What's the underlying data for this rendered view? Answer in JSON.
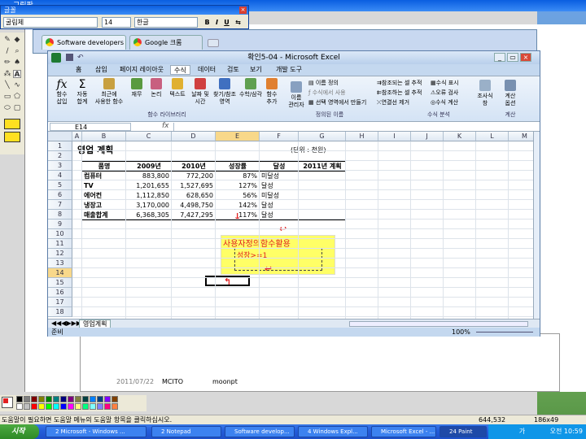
{
  "paint": {
    "title": "그림판",
    "status": "도움말이 필요하면 도움말 메뉴의 도움말 항목을 클릭하십시오.",
    "coords": "644,532",
    "size": "186x49"
  },
  "fontbar": {
    "title": "글꼴",
    "font": "굴림체",
    "size": "14",
    "script": "한글",
    "bold": "B",
    "italic": "I",
    "underline": "U",
    "vertical": "⇆"
  },
  "chrome": {
    "tabs": [
      {
        "label": "Software developers and"
      },
      {
        "label": "Google 크롬"
      }
    ]
  },
  "bg_doc": {
    "date": "2011/07/22",
    "c1": "MCITO",
    "c2": "moonpt"
  },
  "excel": {
    "title": "확인5-04 - Microsoft Excel",
    "menus": [
      "홈",
      "삽입",
      "페이지 레이아웃",
      "수식",
      "데이터",
      "검토",
      "보기",
      "개발 도구"
    ],
    "ribbon": {
      "insert_fn": "함수\n삽입",
      "autosum": "자동\n합계",
      "recent": "최근에\n사용한 함수",
      "finance": "재무",
      "logical": "논리",
      "text": "텍스트",
      "datetime": "날짜 및\n시간",
      "lookup": "찾기/참조\n영역",
      "math": "수학/삼각",
      "more": "함수\n추가",
      "group1": "함수 라이브러리",
      "name_mgr": "이름\n관리자",
      "define_name": "이름 정의",
      "use_formula": "수식에서 사용",
      "create_sel": "선택 영역에서 만들기",
      "group2": "정의된 이름",
      "trace_prec": "참조되는 셀 추적",
      "trace_dep": "참조하는 셀 추적",
      "remove_arrows": "연결선 제거",
      "show_formulas": "수식 표시",
      "error_check": "오류 검사",
      "evaluate": "수식 계산",
      "watch": "조사식\n창",
      "group3": "수식 분석",
      "calc_opts": "계산\n옵션",
      "group4": "계산"
    },
    "namebox": "E14",
    "fx": "fx",
    "columns": [
      "A",
      "B",
      "C",
      "D",
      "E",
      "F",
      "G",
      "H",
      "I",
      "J",
      "K",
      "L",
      "M"
    ],
    "rows": [
      "1",
      "2",
      "3",
      "4",
      "5",
      "6",
      "7",
      "8",
      "9",
      "10",
      "11",
      "12",
      "13",
      "14",
      "15",
      "16",
      "17",
      "18"
    ],
    "sheet_title": "영업 계획",
    "unit": "(단위 : 천원)",
    "headers": [
      "품명",
      "2009년",
      "2010년",
      "성장률",
      "달성",
      "2011년 계획"
    ],
    "data": [
      [
        "컴퓨터",
        "883,800",
        "772,200",
        "87%",
        "미달성",
        ""
      ],
      [
        "TV",
        "1,201,655",
        "1,527,695",
        "127%",
        "달성",
        ""
      ],
      [
        "에어컨",
        "1,112,850",
        "628,650",
        "56%",
        "미달성",
        ""
      ],
      [
        "냉장고",
        "3,170,000",
        "4,498,750",
        "142%",
        "달성",
        ""
      ],
      [
        "매출합계",
        "6,368,305",
        "7,427,295",
        "117%",
        "달성",
        ""
      ]
    ],
    "note_title": "사용자정의함수활용",
    "note_text": "성장>=1",
    "sheet_tab": "영업계획",
    "status": "준비",
    "zoom": "100%"
  },
  "taskbar": {
    "start": "시작",
    "items": [
      {
        "label": "2 Microsoft - Windows ..."
      },
      {
        "label": "2 Notepad"
      },
      {
        "label": "Software develop..."
      },
      {
        "label": "4 Windows Expl..."
      },
      {
        "label": "Microsoft Excel - ..."
      },
      {
        "label": "24 Paint"
      }
    ],
    "tray_lang": "가",
    "clock": "오전 10:59"
  },
  "colors": {
    "accent_red": "#e02020",
    "note_yellow": "#ffff66",
    "xp_blue": "#245edb"
  }
}
